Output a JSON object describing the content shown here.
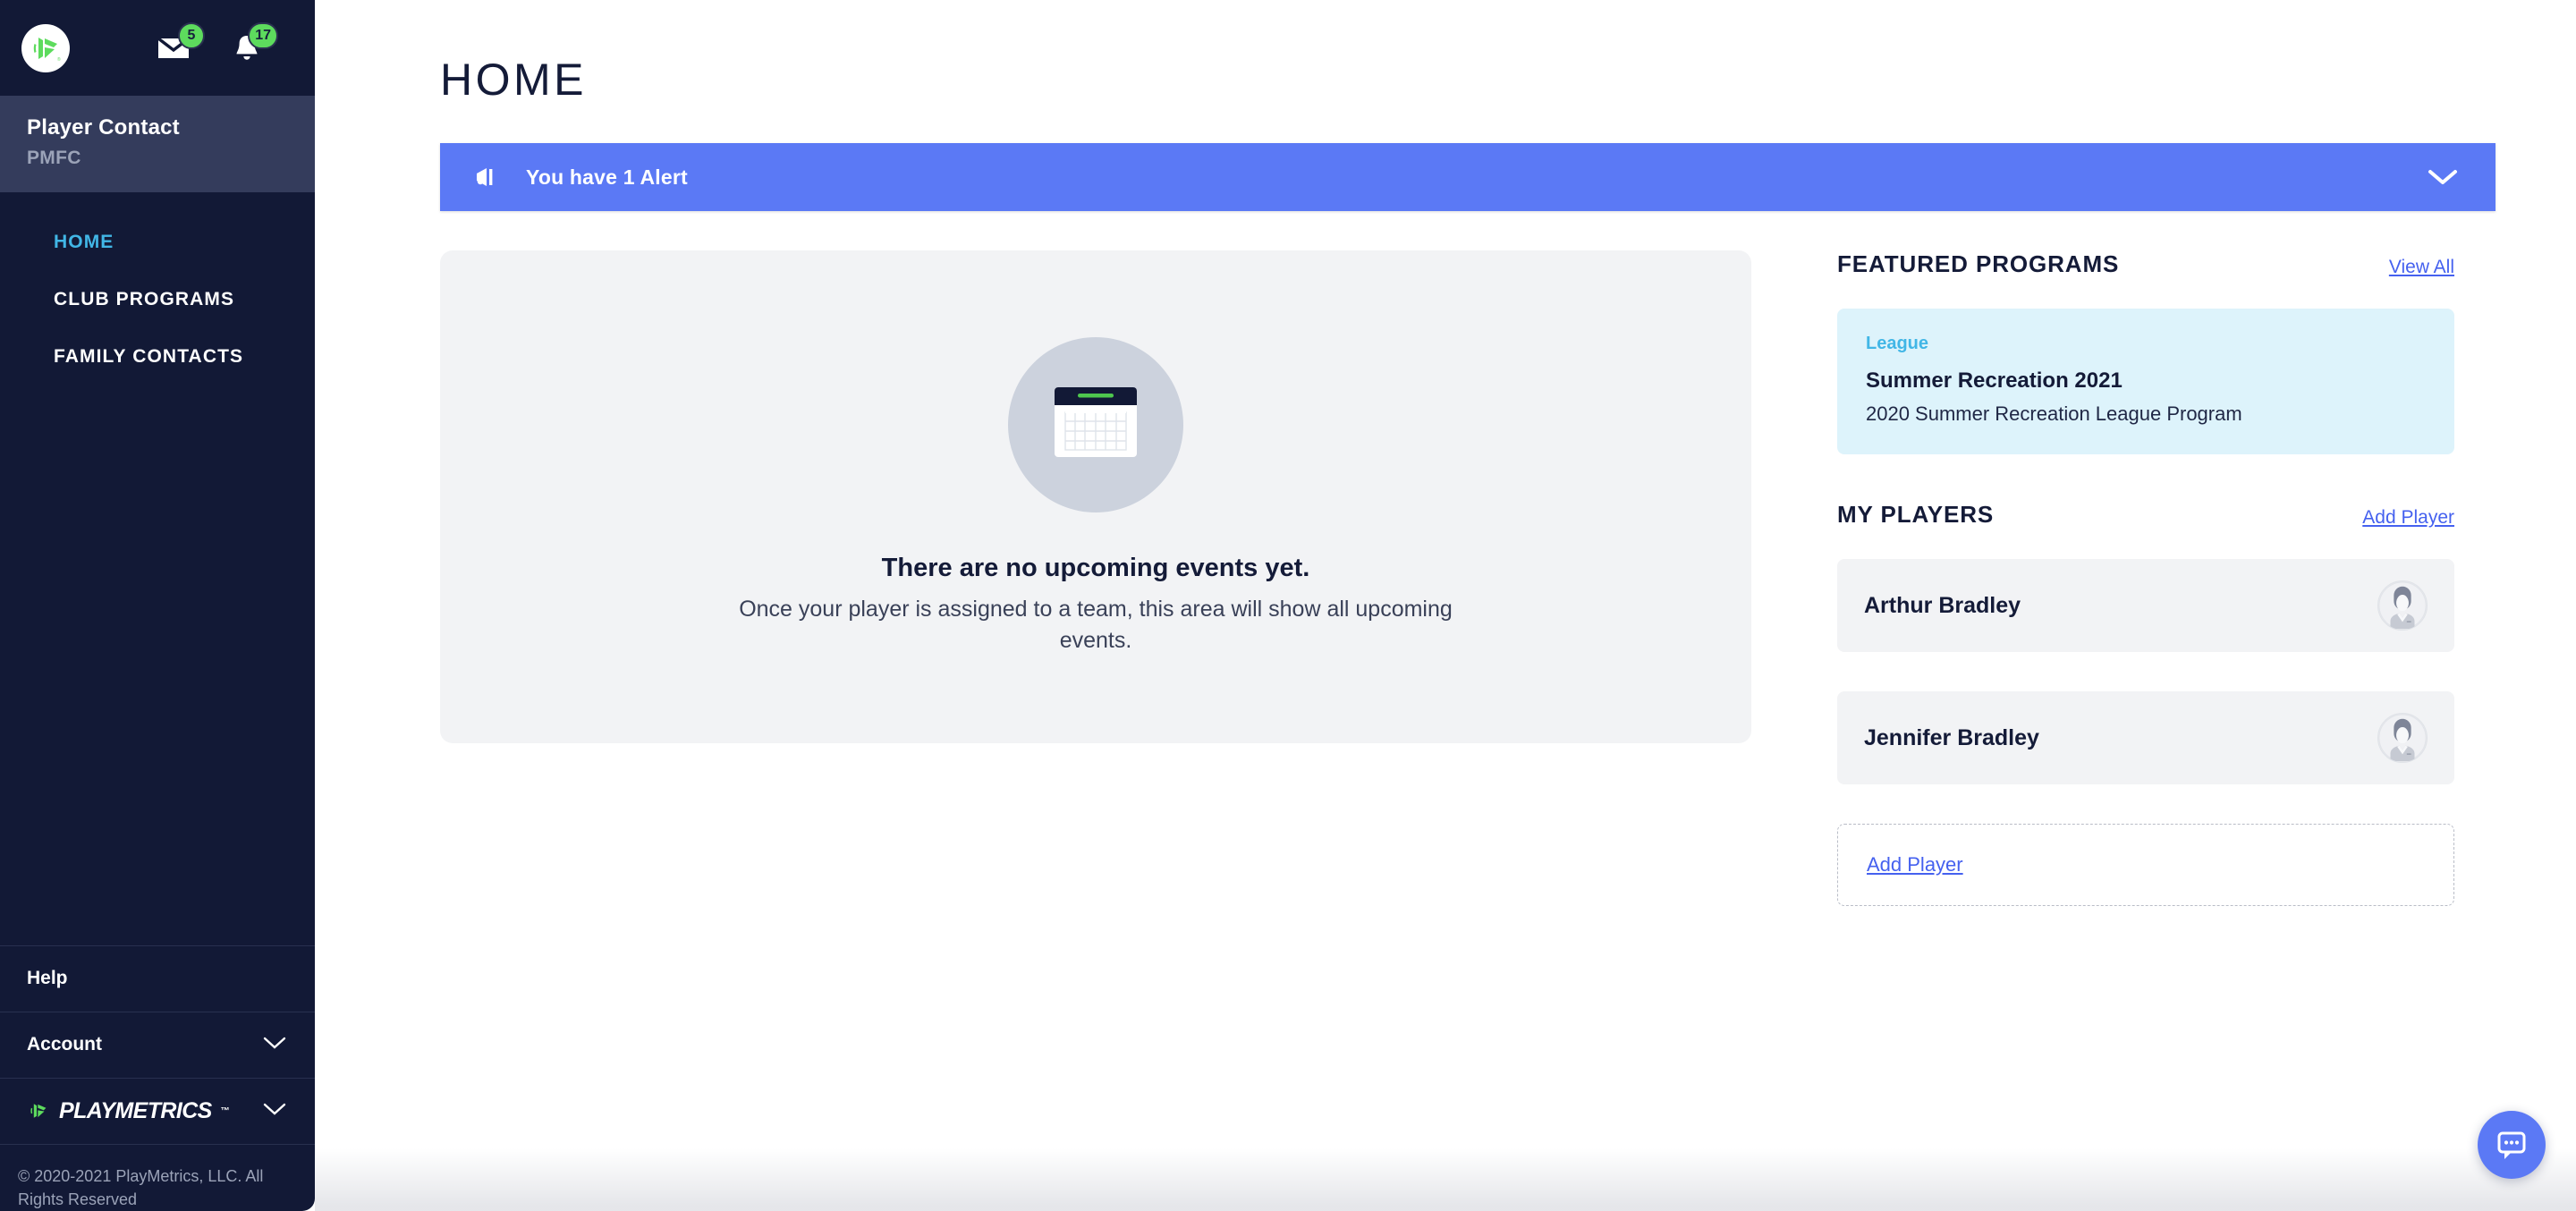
{
  "sidebar": {
    "logo_icon": "playmetrics-mark-icon",
    "messages": {
      "icon": "mail-icon",
      "badge": "5"
    },
    "notifications": {
      "icon": "bell-icon",
      "badge": "17"
    },
    "account_block": {
      "name": "Player Contact",
      "org": "PMFC"
    },
    "nav": [
      {
        "label": "HOME",
        "active": true
      },
      {
        "label": "CLUB PROGRAMS",
        "active": false
      },
      {
        "label": "FAMILY CONTACTS",
        "active": false
      }
    ],
    "help_label": "Help",
    "account_label": "Account",
    "brand_word": "PLAYMETRICS",
    "brand_tm": "™",
    "copyright": "© 2020-2021 PlayMetrics, LLC. All Rights Reserved"
  },
  "main": {
    "page_title": "HOME",
    "alert": {
      "icon": "megaphone-icon",
      "text": "You have 1 Alert",
      "expand_icon": "chevron-down-icon"
    },
    "events_empty": {
      "illustration": "calendar-icon",
      "title": "There are no upcoming events yet.",
      "subtitle": "Once your player is assigned to a team, this area will show all upcoming events."
    }
  },
  "right": {
    "featured": {
      "title": "FEATURED PROGRAMS",
      "view_all": "View All",
      "program": {
        "tag": "League",
        "name": "Summer Recreation 2021",
        "description": "2020 Summer Recreation League Program"
      }
    },
    "players": {
      "title": "MY PLAYERS",
      "add_link": "Add Player",
      "list": [
        {
          "name": "Arthur Bradley",
          "avatar": "person-avatar-icon"
        },
        {
          "name": "Jennifer Bradley",
          "avatar": "person-avatar-icon"
        }
      ],
      "add_box_label": "Add Player"
    }
  },
  "chat": {
    "icon": "chat-bubble-icon"
  },
  "colors": {
    "sidebar_bg": "#121936",
    "sidebar_account_bg": "#343c5c",
    "accent_blue": "#41b6e6",
    "link_blue": "#4561ef",
    "alert_blue": "#5b79f5",
    "brand_green": "#5ddb5d",
    "card_grey": "#f2f3f5",
    "program_card_bg": "#ddf3fb",
    "text_dark": "#141b38"
  }
}
